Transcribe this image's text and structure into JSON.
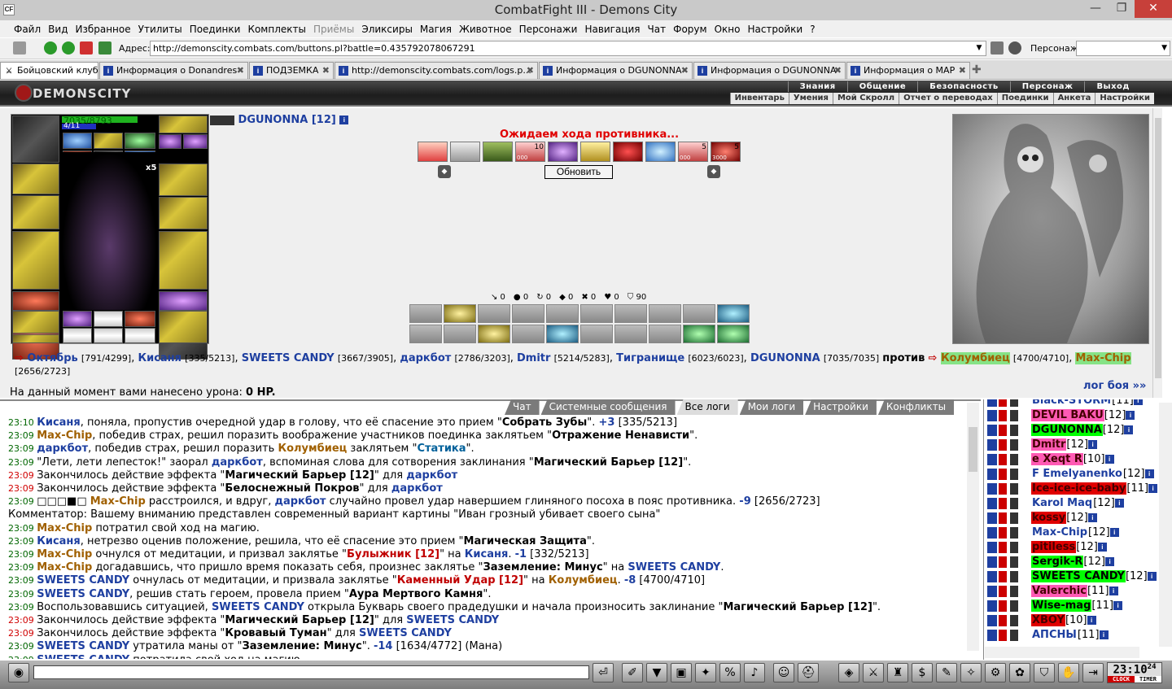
{
  "window": {
    "title": "CombatFight III - Demons City",
    "logo": "CF"
  },
  "menu": [
    "Файл",
    "Вид",
    "Избранное",
    "Утилиты",
    "Поединки",
    "Комплекты",
    "Приёмы",
    "Эликсиры",
    "Магия",
    "Животное",
    "Персонажи",
    "Навигация",
    "Чат",
    "Форум",
    "Окно",
    "Настройки",
    "?"
  ],
  "address": {
    "label": "Адрес:",
    "value": "http://demonscity.combats.com/buttons.pl?battle=0.435792078067291",
    "persona_label": "Персонаж:"
  },
  "tabs": [
    {
      "label": "Бойцовский клуб"
    },
    {
      "label": "Информация о Donandres"
    },
    {
      "label": "ПОДЗЕМКА"
    },
    {
      "label": "http://demonscity.combats.com/logs.p..."
    },
    {
      "label": "Информация о DGUNONNA"
    },
    {
      "label": "Информация о DGUNONNA"
    },
    {
      "label": "Информация о MAP"
    }
  ],
  "game": {
    "brand": "DEMONSCITY",
    "nav_top": [
      "Знания",
      "Общение",
      "Безопасность",
      "Персонаж",
      "Выход"
    ],
    "nav_sub": [
      "Инвентарь",
      "Умения",
      "Мой Скролл",
      "Отчет о переводах",
      "Поединки",
      "Анкета",
      "Настройки"
    ]
  },
  "player": {
    "name": "DGUNONNA",
    "level": "[12]",
    "hp": "7035/8793",
    "hp_fraction": 0.8,
    "mana": "4/11",
    "mana_fraction": 0.36,
    "stack_badge": "x5"
  },
  "battle": {
    "waiting": "Ожидаем хода противника...",
    "refresh": "Обновить",
    "skill_counts": [
      "",
      "",
      "",
      "10",
      "",
      "",
      "",
      "",
      "5",
      "5"
    ],
    "skill_subs": [
      "",
      "",
      "",
      "000",
      "",
      "",
      "",
      "",
      "000",
      "3000"
    ],
    "counters": [
      "↘ 0",
      "● 0",
      "↻ 0",
      "◆ 0",
      "✖ 0",
      "♥ 0",
      "⛉ 90"
    ]
  },
  "fighters": {
    "team1": [
      {
        "name": "Октябрь",
        "hp": "[791/4299]"
      },
      {
        "name": "Кисаня",
        "hp": "[335/5213]"
      },
      {
        "name": "SWEETS CANDY",
        "hp": "[3667/3905]"
      },
      {
        "name": "даркбот",
        "hp": "[2786/3203]"
      },
      {
        "name": "Dmitr",
        "hp": "[5214/5283]"
      },
      {
        "name": "Тигранище",
        "hp": "[6023/6023]"
      },
      {
        "name": "DGUNONNA",
        "hp": "[7035/7035]"
      }
    ],
    "versus": "против",
    "team2": [
      {
        "name": "Колумбиец",
        "hp": "[4700/4710]"
      },
      {
        "name": "Max-Chip",
        "hp": "[2656/2723]"
      }
    ],
    "damage_label": "На данный момент вами нанесено урона:",
    "damage_value": "0 HP.",
    "log_link": "лог боя »»"
  },
  "chat_tabs": [
    "Чат",
    "Системные сообщения",
    "Все логи",
    "Мои логи",
    "Настройки",
    "Конфликты"
  ],
  "chat_lines": [
    {
      "t": "23:10",
      "red": false,
      "parts": [
        [
          "n1",
          "Кисаня"
        ],
        [
          "",
          "Кисаня, поняла, пропустив очередной удар в голову, что её спасение это прием \""
        ],
        [
          "hl",
          "Собрать Зубы"
        ],
        [
          "",
          "\". "
        ],
        [
          "num",
          "+3"
        ],
        [
          "",
          " [335/5213]"
        ]
      ]
    },
    {
      "t": "23:09",
      "red": false,
      "parts": [
        [
          "n2",
          "Max-Chip"
        ],
        [
          "",
          ", победив страх, решил поразить воображение участников поединка заклятьем \""
        ],
        [
          "hl",
          "Отражение Ненависти"
        ],
        [
          "",
          "\"."
        ]
      ]
    },
    {
      "t": "23:09",
      "red": false,
      "parts": [
        [
          "n1",
          "даркбот"
        ],
        [
          "",
          ", победив страх, решил поразить "
        ],
        [
          "n2",
          "Колумбиец"
        ],
        [
          "",
          " заклятьем \""
        ],
        [
          "n3",
          "Статика"
        ],
        [
          "",
          "\"."
        ]
      ]
    },
    {
      "t": "23:09",
      "red": false,
      "parts": [
        [
          "",
          "\"Лети, лети лепесток!\" заорал "
        ],
        [
          "n1",
          "даркбот"
        ],
        [
          "",
          ", вспоминая слова для сотворения заклинания \""
        ],
        [
          "hl",
          "Магический Барьер [12]"
        ],
        [
          "",
          "\"."
        ]
      ]
    },
    {
      "t": "23:09",
      "red": true,
      "parts": [
        [
          "",
          "Закончилось действие эффекта \""
        ],
        [
          "hl",
          "Магический Барьер [12]"
        ],
        [
          "",
          "\" для "
        ],
        [
          "n1",
          "даркбот"
        ]
      ]
    },
    {
      "t": "23:09",
      "red": true,
      "parts": [
        [
          "",
          "Закончилось действие эффекта \""
        ],
        [
          "hl",
          "Белоснежный Покров"
        ],
        [
          "",
          "\" для "
        ],
        [
          "n1",
          "даркбот"
        ]
      ]
    },
    {
      "t": "23:09",
      "red": false,
      "parts": [
        [
          "",
          "□□□■□ "
        ],
        [
          "n2",
          "Max-Chip"
        ],
        [
          "",
          " расстроился, и вдруг, "
        ],
        [
          "n1",
          "даркбот"
        ],
        [
          "",
          " случайно провел удар навершием глиняного посоха в пояс противника. "
        ],
        [
          "num",
          "-9"
        ],
        [
          "",
          " [2656/2723]"
        ]
      ]
    },
    {
      "t": "",
      "red": false,
      "parts": [
        [
          "",
          "Комментатор: Вашему вниманию представлен современный вариант картины \"Иван грозный убивает своего сына\""
        ]
      ]
    },
    {
      "t": "23:09",
      "red": false,
      "parts": [
        [
          "n2",
          "Max-Chip"
        ],
        [
          "",
          " потратил свой ход на магию."
        ]
      ]
    },
    {
      "t": "23:09",
      "red": false,
      "parts": [
        [
          "n1",
          "Кисаня"
        ],
        [
          "",
          ", нетрезво оценив положение, решила, что её спасение это прием \""
        ],
        [
          "hl",
          "Магическая Защита"
        ],
        [
          "",
          "\"."
        ]
      ]
    },
    {
      "t": "23:09",
      "red": false,
      "parts": [
        [
          "n2",
          "Max-Chip"
        ],
        [
          "",
          " очнулся от медитации, и призвал заклятье \""
        ],
        [
          "nred",
          "Булыжник [12]"
        ],
        [
          "",
          "\" на "
        ],
        [
          "n1",
          "Кисаня"
        ],
        [
          "",
          ". "
        ],
        [
          "num",
          "-1"
        ],
        [
          "",
          " [332/5213]"
        ]
      ]
    },
    {
      "t": "23:09",
      "red": false,
      "parts": [
        [
          "n2",
          "Max-Chip"
        ],
        [
          "",
          " догадавшись, что пришло время показать себя, произнес заклятье \""
        ],
        [
          "hl",
          "Заземление: Минус"
        ],
        [
          "",
          "\" на "
        ],
        [
          "n1",
          "SWEETS CANDY"
        ],
        [
          "",
          "."
        ]
      ]
    },
    {
      "t": "23:09",
      "red": false,
      "parts": [
        [
          "n1",
          "SWEETS CANDY"
        ],
        [
          "",
          " очнулась от медитации, и призвала заклятье \""
        ],
        [
          "nred",
          "Каменный Удар [12]"
        ],
        [
          "",
          "\" на "
        ],
        [
          "n2",
          "Колумбиец"
        ],
        [
          "",
          ". "
        ],
        [
          "num",
          "-8"
        ],
        [
          "",
          " [4700/4710]"
        ]
      ]
    },
    {
      "t": "23:09",
      "red": false,
      "parts": [
        [
          "n1",
          "SWEETS CANDY"
        ],
        [
          "",
          ", решив стать героем, провела прием \""
        ],
        [
          "hl",
          "Аура Мертвого Камня"
        ],
        [
          "",
          "\"."
        ]
      ]
    },
    {
      "t": "23:09",
      "red": false,
      "parts": [
        [
          "",
          "Воспользовавшись ситуацией, "
        ],
        [
          "n1",
          "SWEETS CANDY"
        ],
        [
          "",
          " открыла Букварь своего прадедушки и начала произносить заклинание \""
        ],
        [
          "hl",
          "Магический Барьер [12]"
        ],
        [
          "",
          "\"."
        ]
      ]
    },
    {
      "t": "23:09",
      "red": true,
      "parts": [
        [
          "",
          "Закончилось действие эффекта \""
        ],
        [
          "hl",
          "Магический Барьер [12]"
        ],
        [
          "",
          "\" для "
        ],
        [
          "n1",
          "SWEETS CANDY"
        ]
      ]
    },
    {
      "t": "23:09",
      "red": true,
      "parts": [
        [
          "",
          "Закончилось действие эффекта \""
        ],
        [
          "hl",
          "Кровавый Туман"
        ],
        [
          "",
          "\" для "
        ],
        [
          "n1",
          "SWEETS CANDY"
        ]
      ]
    },
    {
      "t": "23:09",
      "red": false,
      "parts": [
        [
          "n1",
          "SWEETS CANDY"
        ],
        [
          "",
          " утратила маны от \""
        ],
        [
          "hl",
          "Заземление: Минус"
        ],
        [
          "",
          "\". "
        ],
        [
          "num",
          "-14"
        ],
        [
          "",
          " [1634/4772] (Мана)"
        ]
      ]
    },
    {
      "t": "23:09",
      "red": false,
      "parts": [
        [
          "n1",
          "SWEETS CANDY"
        ],
        [
          "",
          " потратила свой ход на магию."
        ]
      ]
    }
  ],
  "users": [
    {
      "name": "Black-STORM",
      "level": "[11]",
      "bg": ""
    },
    {
      "name": "DEVIL BAKU",
      "level": "[12]",
      "bg": "bgp"
    },
    {
      "name": "DGUNONNA",
      "level": "[12]",
      "bg": "bgg"
    },
    {
      "name": "Dmitr",
      "level": "[12]",
      "bg": "bgp"
    },
    {
      "name": "e Xeqt R",
      "level": "[10]",
      "bg": "bgp"
    },
    {
      "name": "F Emelyanenko",
      "level": "[12]",
      "bg": ""
    },
    {
      "name": "Ice-ice-ice-baby",
      "level": "[11]",
      "bg": "bgr"
    },
    {
      "name": "Karol Maq",
      "level": "[12]",
      "bg": ""
    },
    {
      "name": "kossy",
      "level": "[12]",
      "bg": "bgr"
    },
    {
      "name": "Max-Chip",
      "level": "[12]",
      "bg": ""
    },
    {
      "name": "pitiless",
      "level": "[12]",
      "bg": "bgr"
    },
    {
      "name": "Sergik-R",
      "level": "[12]",
      "bg": "bgg"
    },
    {
      "name": "SWEETS CANDY",
      "level": "[12]",
      "bg": "bgg"
    },
    {
      "name": "Valerchic",
      "level": "[11]",
      "bg": "bgp"
    },
    {
      "name": "Wise-mag",
      "level": "[11]",
      "bg": "bgg"
    },
    {
      "name": "XBOY",
      "level": "[10]",
      "bg": "bgr"
    },
    {
      "name": "АПСНЫ",
      "level": "[11]",
      "bg": ""
    }
  ],
  "clock": {
    "time": "23:10",
    "seconds": "24",
    "clock_label": "CLOCK",
    "timer_label": "TIMER"
  }
}
